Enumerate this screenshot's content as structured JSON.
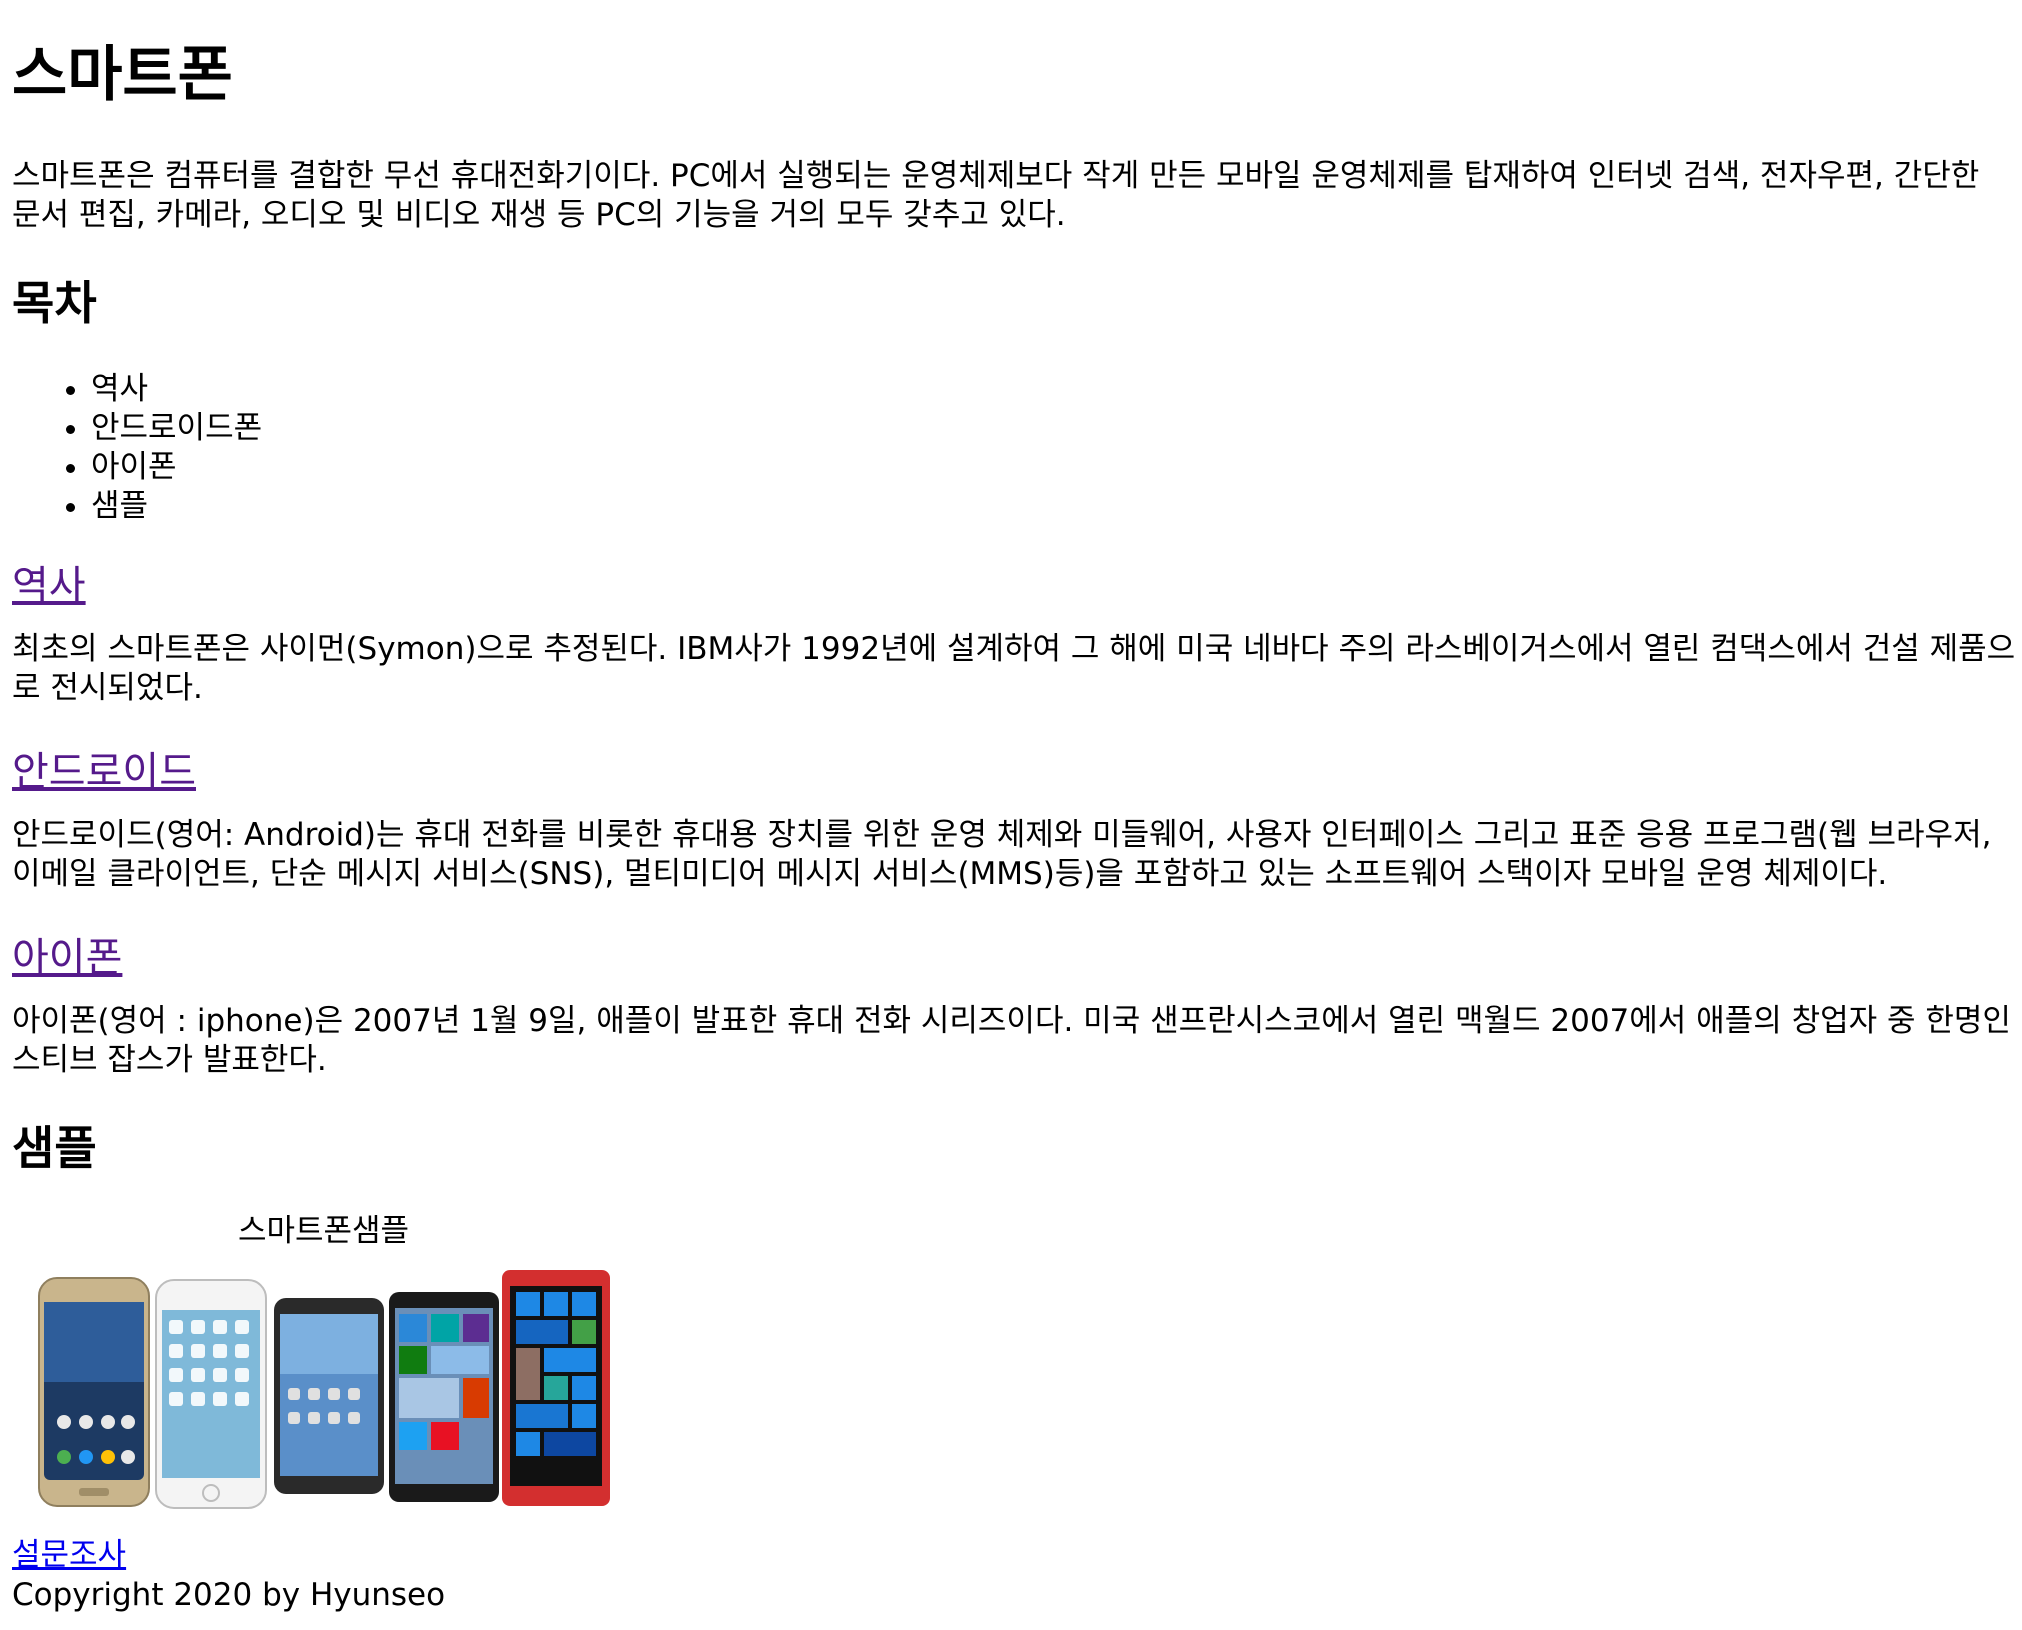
{
  "title": "스마트폰",
  "intro": "스마트폰은 컴퓨터를 결합한 무선 휴대전화기이다. PC에서 실행되는 운영체제보다 작게 만든 모바일 운영체제를 탑재하여 인터넷 검색, 전자우편, 간단한 문서 편집, 카메라, 오디오 및 비디오 재생 등 PC의 기능을 거의 모두 갖추고 있다.",
  "toc": {
    "heading": "목차",
    "items": [
      "역사",
      "안드로이드폰",
      "아이폰",
      "샘플"
    ]
  },
  "sections": [
    {
      "heading": "역사",
      "text": "최초의 스마트폰은 사이먼(Symon)으로 추정된다. IBM사가 1992년에 설계하여 그 해에 미국 네바다 주의 라스베이거스에서 열린 컴댁스에서 건설 제품으로 전시되었다."
    },
    {
      "heading": "안드로이드",
      "text": "안드로이드(영어: Android)는 휴대 전화를 비롯한 휴대용 장치를 위한 운영 체제와 미들웨어, 사용자 인터페이스 그리고 표준 응용 프로그램(웹 브라우저, 이메일 클라이언트, 단순 메시지 서비스(SNS), 멀티미디어 메시지 서비스(MMS)등)을 포함하고 있는 소프트웨어 스택이자 모바일 운영 체제이다."
    },
    {
      "heading": "아이폰",
      "text": "아이폰(영어 : iphone)은 2007년 1월 9일, 애플이 발표한 휴대 전화 시리즈이다. 미국 샌프란시스코에서 열린 맥월드 2007에서 애플의 창업자 중 한명인 스티브 잡스가 발표한다."
    }
  ],
  "sample": {
    "heading": "샘플",
    "caption": "스마트폰샘플"
  },
  "footer": {
    "survey_link": "설문조사",
    "copyright": "Copyright 2020 by Hyunseo"
  },
  "colors": {
    "visited_link": "#551a8b",
    "link": "#0000ee"
  }
}
